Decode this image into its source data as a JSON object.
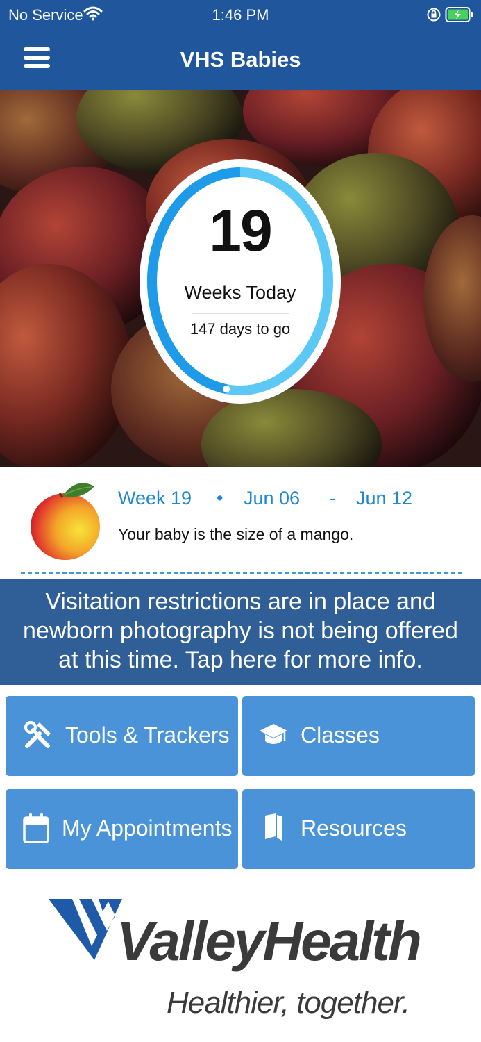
{
  "status_bar": {
    "carrier": "No Service",
    "time": "1:46 PM"
  },
  "nav": {
    "title": "VHS Babies",
    "menu_icon": "hamburger-icon"
  },
  "progress": {
    "weeks": "19",
    "weeks_label": "Weeks Today",
    "days_to_go": "147 days to go",
    "fraction_complete": 0.475
  },
  "week_info": {
    "week_label": "Week 19",
    "bullet": "•",
    "start_date": "Jun 06",
    "dash": "-",
    "end_date": "Jun 12",
    "size_text": "Your baby is the size of a mango."
  },
  "banner": {
    "lines": [
      "Visitation restrictions are in place and",
      "newborn photography is not being offered",
      "at this time. Tap here for more info."
    ]
  },
  "tiles": [
    {
      "label": "Tools & Trackers",
      "icon": "tools-icon"
    },
    {
      "label": "Classes",
      "icon": "graduation-cap-icon"
    },
    {
      "label": "My Appointments",
      "icon": "calendar-icon"
    },
    {
      "label": "Resources",
      "icon": "book-icon"
    }
  ],
  "logo": {
    "brand": "ValleyHealth",
    "tagline": "Healthier, together."
  },
  "colors": {
    "header": "#1f569c",
    "tile": "#4a93d8",
    "banner": "#2f5f96",
    "accent_text": "#1e88d4",
    "progress_ring": "#1e9be8",
    "progress_track": "#5cc8f5"
  }
}
